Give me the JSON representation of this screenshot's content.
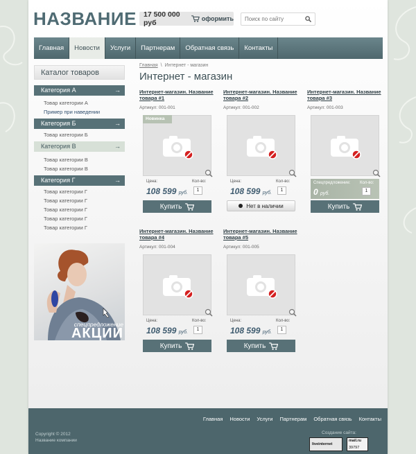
{
  "header": {
    "logo": "НАЗВАНИЕ",
    "cart_sum": "17 500 000 руб",
    "cart_order": "оформить",
    "search_placeholder": "Поиск по сайту"
  },
  "nav": [
    "Главная",
    "Новости",
    "Услуги",
    "Партнерам",
    "Обратная связь",
    "Контакты"
  ],
  "nav_active": 1,
  "sidebar": {
    "title": "Каталог товаров",
    "categories": [
      {
        "name": "Категория А",
        "items": [
          "Товар категории А",
          "Пример при наведении"
        ]
      },
      {
        "name": "Категория Б",
        "items": [
          "Товар категории Б"
        ]
      },
      {
        "name": "Категория В",
        "items": [
          "Товар категории В",
          "Товар категории В"
        ]
      },
      {
        "name": "Категория Г",
        "items": [
          "Товар категории Г",
          "Товар категории Г",
          "Товар категории Г",
          "Товар категории Г",
          "Товар категории Г"
        ]
      }
    ],
    "arrow": "→",
    "promo_small": "спецпредложение",
    "promo_big": "АКЦИИ"
  },
  "main": {
    "breadcrumb_home": "Главная",
    "breadcrumb_sep": "\\",
    "breadcrumb_current": "Интернет - магазин",
    "title": "Интернет - магазин"
  },
  "labels": {
    "price": "Цена:",
    "qty": "Кол-во:",
    "buy": "Купить",
    "out_of_stock": "Нет в наличии",
    "special_price": "Спецпредложение:",
    "badge_new": "Новинка",
    "currency": "руб."
  },
  "products": [
    {
      "title": "Интернет-магазин. Название товара #1",
      "sku": "Артикул: 001-001",
      "price": "108 599",
      "qty": "1"
    },
    {
      "title": "Интернет-магазин. Название товара #2",
      "sku": "Артикул: 001-002",
      "price": "108 599",
      "qty": "1"
    },
    {
      "title": "Интернет-магазин. Название товара #3",
      "sku": "Артикул: 001-003",
      "price": "0",
      "qty": "1"
    },
    {
      "title": "Интернет-магазин. Название товара #4",
      "sku": "Артикул: 001-004",
      "price": "108 599",
      "qty": "1"
    },
    {
      "title": "Интернет-магазин. Название товара #5",
      "sku": "Артикул: 001-005",
      "price": "108 599",
      "qty": "1"
    }
  ],
  "footer": {
    "nav": [
      "Главная",
      "Новости",
      "Услуги",
      "Партнерам",
      "Обратная связь",
      "Контакты"
    ],
    "copyright": "Copyright © 2012",
    "company": "Название компании",
    "created": "Создание сайта:",
    "counter_li": "liveinternet",
    "counter_mail": "mail.ru",
    "counter_mail_value": "39797"
  },
  "colors": {
    "accent": "#577177",
    "logo": "#4f6b73",
    "footer": "#4d666c",
    "price": "#3d5a6e"
  }
}
